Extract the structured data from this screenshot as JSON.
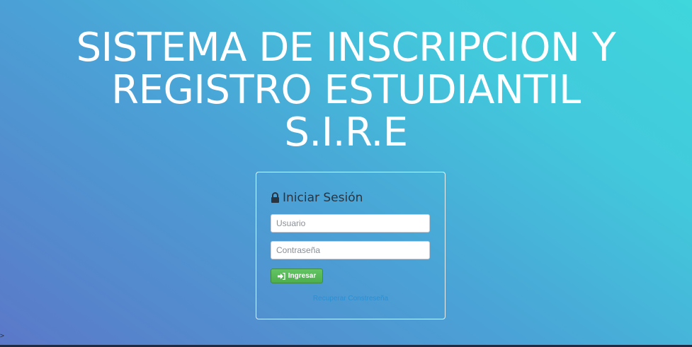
{
  "hero": {
    "line1": "SISTEMA DE INSCRIPCION Y",
    "line2": "REGISTRO ESTUDIANTIL",
    "line3": "S.I.R.E"
  },
  "login": {
    "heading": "Iniciar Sesión",
    "heading_icon": "lock-icon",
    "username_placeholder": "Usuario",
    "password_placeholder": "Contraseña",
    "submit_label": "Ingresar",
    "submit_icon": "sign-in-icon",
    "recover_link": "Recuperar Constreseña"
  },
  "corner_marker": ">",
  "colors": {
    "button_green": "#5cb85c",
    "link_blue": "#2d8fd0",
    "background_start": "#5b78c8",
    "background_end": "#3fd6dc"
  }
}
